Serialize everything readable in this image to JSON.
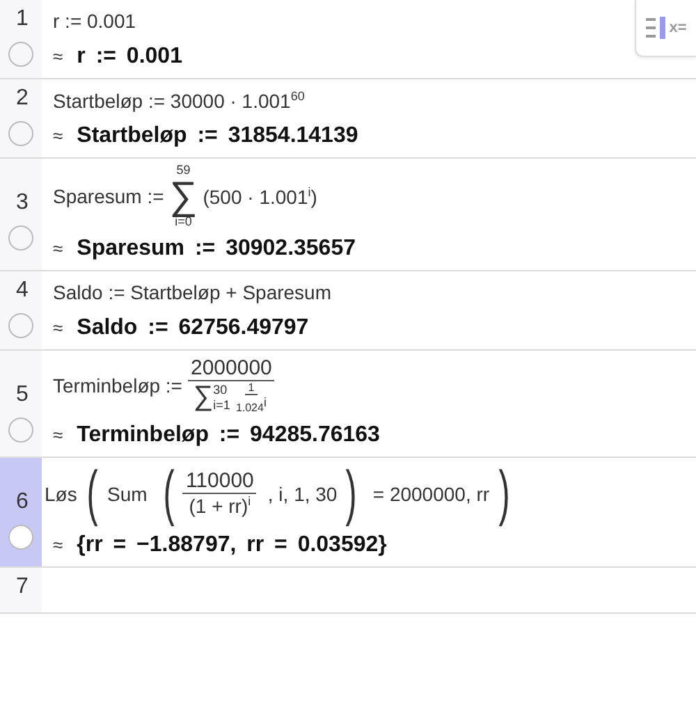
{
  "toolbar": {
    "toggle_label": "x="
  },
  "rows": [
    {
      "number": "1",
      "selected": false,
      "input": [
        {
          "kind": "text",
          "text": "r := 0.001"
        }
      ],
      "approx": "≈",
      "output": "r := 0.001"
    },
    {
      "number": "2",
      "selected": false,
      "input": [
        {
          "kind": "text",
          "text": "Startbeløp := 30000 · 1.001$^{60}$"
        }
      ],
      "approx": "≈",
      "output": "Startbeløp := 31854.14139"
    },
    {
      "number": "3",
      "selected": false,
      "input": [
        {
          "kind": "text",
          "text": "Sparesum :="
        },
        {
          "kind": "sum",
          "symbol": "∑",
          "upper": "59",
          "lower": "i=0"
        },
        {
          "kind": "text",
          "text": "(500 · 1.001$^{i}$)"
        }
      ],
      "approx": "≈",
      "output": "Sparesum := 30902.35657"
    },
    {
      "number": "4",
      "selected": false,
      "input": [
        {
          "kind": "text",
          "text": "Saldo := Startbeløp + Sparesum"
        }
      ],
      "approx": "≈",
      "output": "Saldo := 62756.49797"
    },
    {
      "number": "5",
      "selected": false,
      "input": [
        {
          "kind": "text",
          "text": "Terminbeløp :="
        },
        {
          "kind": "frac",
          "num": [
            {
              "kind": "text",
              "text": "2000000"
            }
          ],
          "den": [
            {
              "kind": "inline-sum",
              "symbol": "∑",
              "upper": "30",
              "lower": "i=1"
            },
            {
              "kind": "frac",
              "num": [
                {
                  "kind": "text",
                  "text": "1"
                }
              ],
              "den": [
                {
                  "kind": "text",
                  "text": "1.024$^{i}$"
                }
              ]
            }
          ]
        }
      ],
      "approx": "≈",
      "output": "Terminbeløp := 94285.76163"
    },
    {
      "number": "6",
      "selected": true,
      "input": [
        {
          "kind": "text",
          "text": "Løs"
        },
        {
          "kind": "paren",
          "open": "(",
          "close": ")",
          "body": [
            {
              "kind": "text",
              "text": "Sum"
            },
            {
              "kind": "paren",
              "open": "(",
              "close": ")",
              "body": [
                {
                  "kind": "frac",
                  "num": [
                    {
                      "kind": "text",
                      "text": "110000"
                    }
                  ],
                  "den": [
                    {
                      "kind": "text",
                      "text": "(1 + rr)$^{i}$"
                    }
                  ]
                },
                {
                  "kind": "text",
                  "text": ", i, 1, 30"
                }
              ]
            },
            {
              "kind": "text",
              "text": "= 2000000, rr"
            }
          ]
        }
      ],
      "approx": "≈",
      "output": "{rr = −1.88797, rr = 0.03592}"
    },
    {
      "number": "7",
      "selected": false,
      "input": []
    }
  ]
}
